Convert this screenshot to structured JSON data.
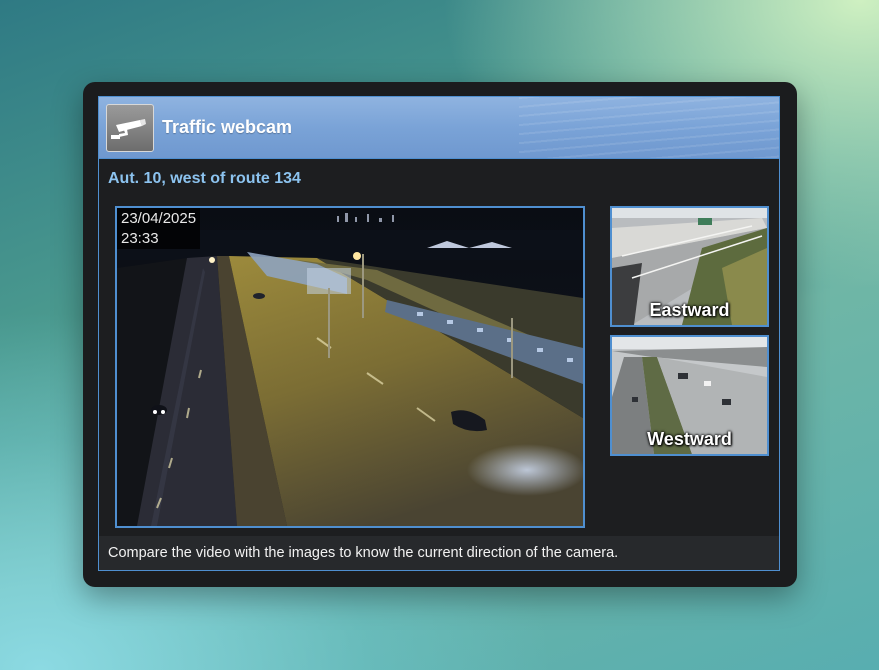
{
  "widget": {
    "title": "Traffic webcam",
    "logo_icon": "security-camera-icon",
    "location": "Aut. 10, west of route 134"
  },
  "main_camera": {
    "date": "23/04/2025",
    "time": "23:33"
  },
  "reference_images": [
    {
      "label": "Eastward"
    },
    {
      "label": "Westward"
    }
  ],
  "footer": {
    "note": "Compare the video with the images to know the current direction of the camera."
  },
  "colors": {
    "accent_border": "#4f8fd0",
    "header_blue": "#7aa3d7",
    "location_text": "#8cc3ef",
    "panel_bg": "#1d1e20"
  }
}
